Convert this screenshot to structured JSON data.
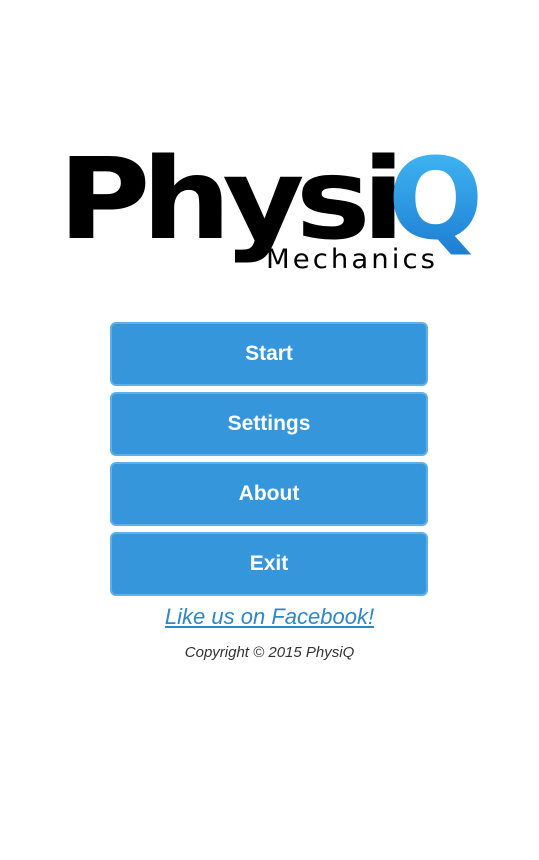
{
  "logo": {
    "name_dark": "Physi",
    "name_accent": "Q",
    "subtitle": "Mechanics",
    "colors": {
      "dark": "#000000",
      "accent_light": "#39b6f4",
      "accent_dark": "#1c7ed3"
    }
  },
  "menu": {
    "start_label": "Start",
    "settings_label": "Settings",
    "about_label": "About",
    "exit_label": "Exit",
    "button_color": "#3596db",
    "button_text_color": "#ffffff"
  },
  "footer": {
    "facebook_link": "Like us on Facebook!",
    "copyright": "Copyright © 2015 PhysiQ",
    "link_color": "#2f86c6"
  }
}
